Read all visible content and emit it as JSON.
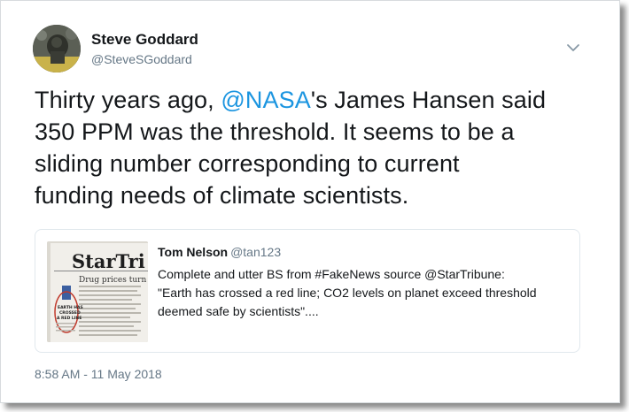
{
  "author": {
    "name": "Steve Goddard",
    "handle": "@SteveSGoddard",
    "avatar_icon": "profile-photo"
  },
  "menu": {
    "icon": "chevron-down-icon"
  },
  "tweet": {
    "lines": [
      {
        "pre": "Thirty years ago, ",
        "mention": "@NASA",
        "post": "'s James Hansen said"
      },
      {
        "text": "350 PPM was the threshold. It seems to be a"
      },
      {
        "text": "sliding number corresponding to current"
      },
      {
        "text": "funding needs of climate scientists."
      }
    ]
  },
  "quoted_tweet": {
    "name": "Tom Nelson",
    "handle": "@tan123",
    "lines": [
      "Complete and utter BS from #FakeNews source @StarTribune:",
      "\"Earth has crossed a red line; CO2 levels on planet exceed threshold",
      "deemed safe by scientists\"...."
    ],
    "image": {
      "masthead": "StarTri",
      "headline": "Drug prices turn",
      "circled_text": [
        "EARTH HAS",
        "CROSSED",
        "A RED LINE"
      ]
    }
  },
  "timestamp": "8:58 AM - 11 May 2018",
  "colors": {
    "link": "#1b95e0",
    "secondary_text": "#657786",
    "border": "#e1e8ed"
  }
}
